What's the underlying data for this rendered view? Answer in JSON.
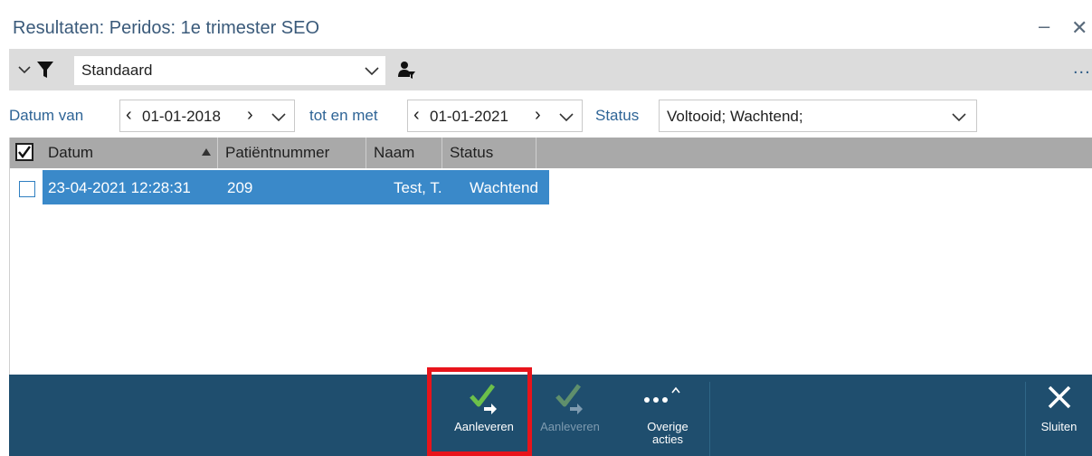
{
  "window": {
    "title": "Resultaten: Peridos: 1e trimester SEO",
    "minimize_glyph": "–",
    "close_glyph": "✕"
  },
  "filter": {
    "selected": "Standaard",
    "more_label": "..."
  },
  "dates": {
    "from_label": "Datum van",
    "from_value": "01-01-2018",
    "to_label": "tot en met",
    "to_value": "01-01-2021",
    "status_label": "Status",
    "status_value": "Voltooid; Wachtend;"
  },
  "table": {
    "columns": [
      "Datum",
      "Patiëntnummer",
      "Naam",
      "Status"
    ],
    "rows": [
      [
        "23-04-2021 12:28:31",
        "209",
        "Test, T.",
        "Wachtend"
      ]
    ]
  },
  "toolbar": {
    "deliver_label": "Aanleveren",
    "deliver_disabled_label": "Aanleveren",
    "more_line1": "Overige",
    "more_line2": "acties",
    "close_label": "Sluiten"
  },
  "colors": {
    "toolbar_bg": "#1f4e6e",
    "selection": "#3a89c9",
    "highlight": "#e8141b",
    "check_green": "#5cb85c"
  }
}
